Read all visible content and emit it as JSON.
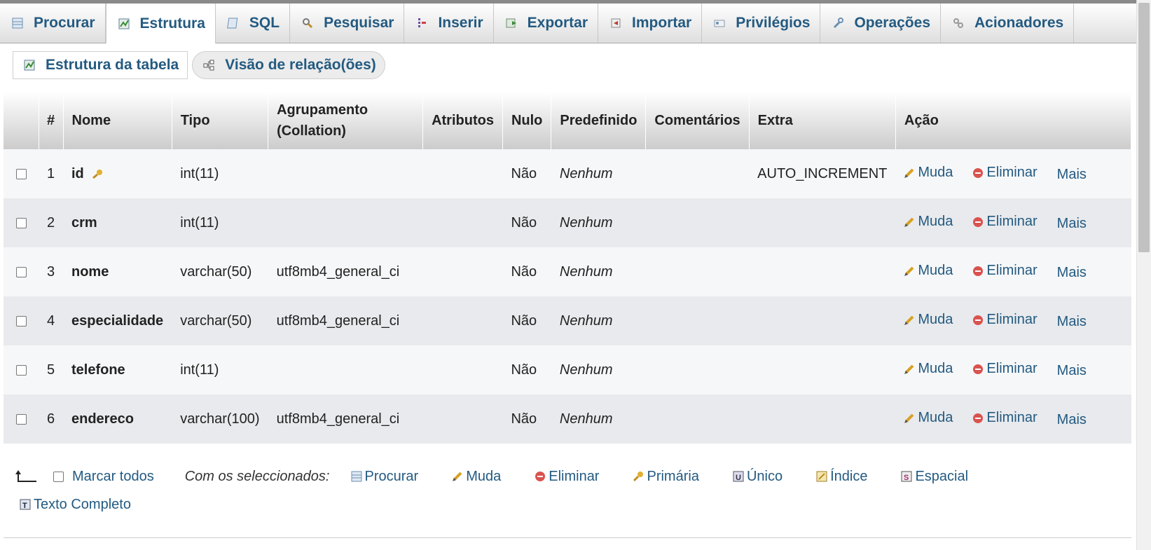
{
  "tabs": [
    {
      "label": "Procurar",
      "icon": "browse-icon"
    },
    {
      "label": "Estrutura",
      "icon": "structure-icon",
      "active": true
    },
    {
      "label": "SQL",
      "icon": "sql-icon"
    },
    {
      "label": "Pesquisar",
      "icon": "search-icon"
    },
    {
      "label": "Inserir",
      "icon": "insert-icon"
    },
    {
      "label": "Exportar",
      "icon": "export-icon"
    },
    {
      "label": "Importar",
      "icon": "import-icon"
    },
    {
      "label": "Privilégios",
      "icon": "privileges-icon"
    },
    {
      "label": "Operações",
      "icon": "wrench-icon"
    },
    {
      "label": "Acionadores",
      "icon": "triggers-icon"
    }
  ],
  "subtabs": {
    "structure": "Estrutura da tabela",
    "relations": "Visão de relação(ões)"
  },
  "table": {
    "headers": [
      "#",
      "Nome",
      "Tipo",
      "Agrupamento (Collation)",
      "Atributos",
      "Nulo",
      "Predefinido",
      "Comentários",
      "Extra",
      "Ação"
    ],
    "action_labels": {
      "change": "Muda",
      "drop": "Eliminar",
      "more": "Mais"
    },
    "rows": [
      {
        "num": "1",
        "name": "id",
        "primary_key": true,
        "type": "int(11)",
        "collation": "",
        "attributes": "",
        "null": "Não",
        "default": "Nenhum",
        "comments": "",
        "extra": "AUTO_INCREMENT"
      },
      {
        "num": "2",
        "name": "crm",
        "type": "int(11)",
        "collation": "",
        "attributes": "",
        "null": "Não",
        "default": "Nenhum",
        "comments": "",
        "extra": ""
      },
      {
        "num": "3",
        "name": "nome",
        "type": "varchar(50)",
        "collation": "utf8mb4_general_ci",
        "attributes": "",
        "null": "Não",
        "default": "Nenhum",
        "comments": "",
        "extra": ""
      },
      {
        "num": "4",
        "name": "especialidade",
        "type": "varchar(50)",
        "collation": "utf8mb4_general_ci",
        "attributes": "",
        "null": "Não",
        "default": "Nenhum",
        "comments": "",
        "extra": ""
      },
      {
        "num": "5",
        "name": "telefone",
        "type": "int(11)",
        "collation": "",
        "attributes": "",
        "null": "Não",
        "default": "Nenhum",
        "comments": "",
        "extra": ""
      },
      {
        "num": "6",
        "name": "endereco",
        "type": "varchar(100)",
        "collation": "utf8mb4_general_ci",
        "attributes": "",
        "null": "Não",
        "default": "Nenhum",
        "comments": "",
        "extra": ""
      }
    ]
  },
  "bulk": {
    "check_all": "Marcar todos",
    "with_selected": "Com os seleccionados:",
    "actions": [
      {
        "label": "Procurar",
        "icon": "browse-icon"
      },
      {
        "label": "Muda",
        "icon": "pencil-icon"
      },
      {
        "label": "Eliminar",
        "icon": "drop-icon"
      },
      {
        "label": "Primária",
        "icon": "key-icon"
      },
      {
        "label": "Único",
        "icon": "unique-icon"
      },
      {
        "label": "Índice",
        "icon": "index-icon"
      },
      {
        "label": "Espacial",
        "icon": "spatial-icon"
      }
    ],
    "fulltext": "Texto Completo"
  },
  "colors": {
    "link": "#235a81",
    "row_odd": "#f6f7f8",
    "row_even": "#e8eaed",
    "drop_red": "#d9534f"
  }
}
